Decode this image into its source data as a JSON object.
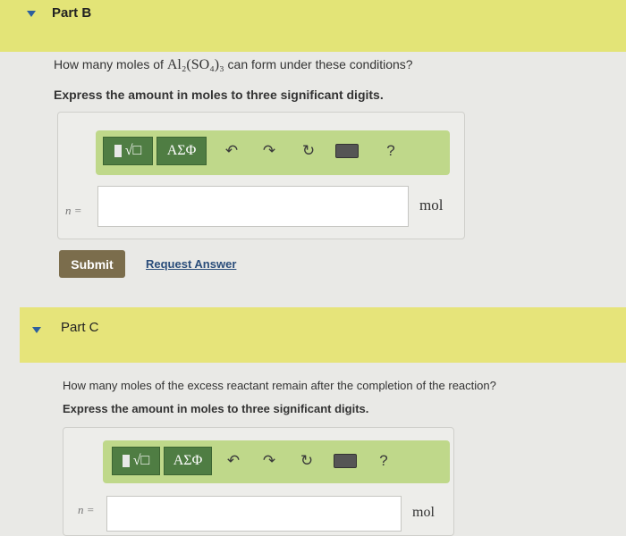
{
  "partB": {
    "title": "Part B",
    "question_pre": "How many moles of ",
    "formula": "Al₂(SO₄)₃",
    "question_post": " can form under these conditions?",
    "instruction": "Express the amount in moles to three significant digits.",
    "toolbar": {
      "template_label": "√□",
      "symbols_label": "ΑΣΦ",
      "undo": "↶",
      "redo": "↷",
      "reset": "↻",
      "help": "?"
    },
    "var_label": "n =",
    "input_value": "",
    "unit": "mol",
    "submit_label": "Submit",
    "request_label": "Request Answer"
  },
  "partC": {
    "title": "Part C",
    "question": "How many moles of the excess reactant remain after the completion of the reaction?",
    "instruction": "Express the amount in moles to three significant digits.",
    "toolbar": {
      "template_label": "√□",
      "symbols_label": "ΑΣΦ",
      "undo": "↶",
      "redo": "↷",
      "reset": "↻",
      "help": "?"
    },
    "var_label": "n =",
    "input_value": "",
    "unit": "mol"
  },
  "colors": {
    "band": "#e3e477",
    "toolbar": "#bfd88a",
    "button_green": "#4f7d43",
    "submit": "#7b6d4c",
    "link": "#2a4d7a"
  }
}
